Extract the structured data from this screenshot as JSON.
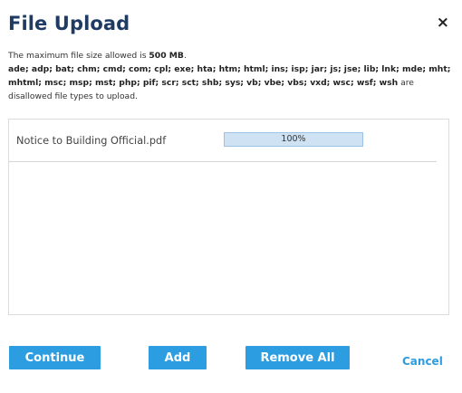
{
  "dialog": {
    "title": "File Upload",
    "close_glyph": "×"
  },
  "info": {
    "max_size_prefix": "The maximum file size allowed is ",
    "max_size_value": "500 MB",
    "max_size_suffix": ".",
    "disallowed_types": "ade; adp; bat; chm; cmd; com; cpl; exe; hta; htm; html; ins; isp; jar; js; jse; lib; lnk; mde; mht; mhtml; msc; msp; mst; php; pif; scr; sct; shb; sys; vb; vbe; vbs; vxd; wsc; wsf; wsh",
    "disallowed_suffix": " are disallowed file types to upload."
  },
  "files": [
    {
      "name": "Notice to Building Official.pdf",
      "progress_percent": 100,
      "progress_label": "100%"
    }
  ],
  "buttons": {
    "continue": "Continue",
    "add": "Add",
    "remove_all": "Remove All",
    "cancel": "Cancel"
  },
  "colors": {
    "title": "#1f3b63",
    "button_bg": "#2b9de0",
    "cancel_link": "#2b9de0",
    "progress_bg": "#d8e8f5",
    "progress_border": "#9cc3e4"
  },
  "icons": {
    "close": "close-icon"
  }
}
